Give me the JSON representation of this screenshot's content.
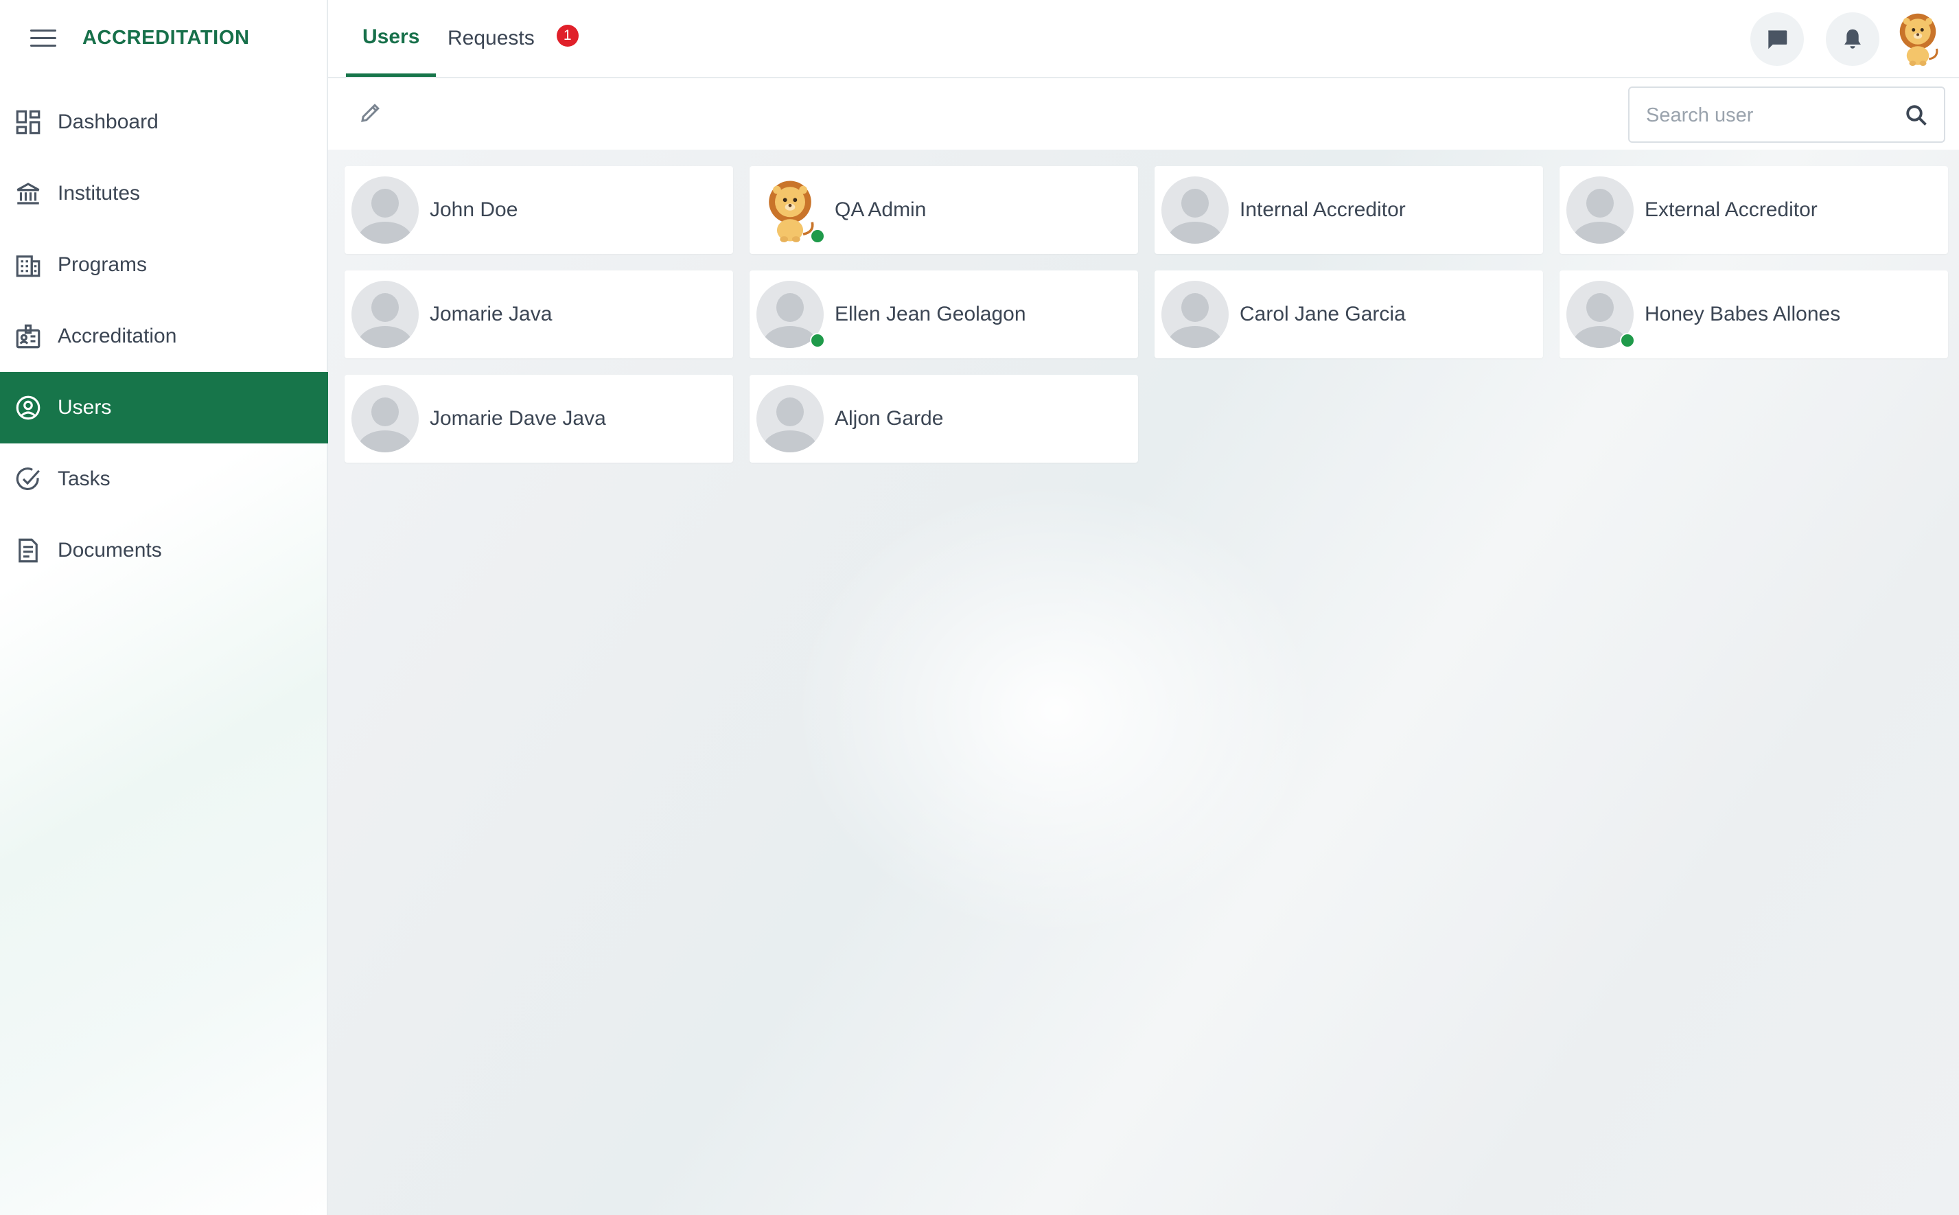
{
  "app": {
    "title": "ACCREDITATION"
  },
  "sidebar": {
    "items": [
      {
        "label": "Dashboard",
        "icon": "dashboard-icon",
        "active": false
      },
      {
        "label": "Institutes",
        "icon": "institution-icon",
        "active": false
      },
      {
        "label": "Programs",
        "icon": "building-icon",
        "active": false
      },
      {
        "label": "Accreditation",
        "icon": "id-badge-icon",
        "active": false
      },
      {
        "label": "Users",
        "icon": "user-circle-icon",
        "active": true
      },
      {
        "label": "Tasks",
        "icon": "check-circle-icon",
        "active": false
      },
      {
        "label": "Documents",
        "icon": "document-icon",
        "active": false
      }
    ]
  },
  "header": {
    "tabs": [
      {
        "label": "Users",
        "active": true
      },
      {
        "label": "Requests",
        "active": false,
        "badge": "1"
      }
    ],
    "actions": [
      "chat-icon",
      "bell-icon"
    ],
    "user_avatar": "lion-avatar"
  },
  "toolbar": {
    "edit_icon": "pencil-icon",
    "search": {
      "placeholder": "Search user",
      "value": ""
    }
  },
  "users": [
    {
      "name": "John Doe",
      "avatar": "default",
      "online": false
    },
    {
      "name": "QA Admin",
      "avatar": "lion",
      "online": true
    },
    {
      "name": "Internal Accreditor",
      "avatar": "default",
      "online": false
    },
    {
      "name": "External Accreditor",
      "avatar": "default",
      "online": false
    },
    {
      "name": "Jomarie Java",
      "avatar": "default",
      "online": false
    },
    {
      "name": "Ellen Jean Geolagon",
      "avatar": "default",
      "online": true
    },
    {
      "name": "Carol Jane Garcia",
      "avatar": "default",
      "online": false
    },
    {
      "name": "Honey Babes Allones",
      "avatar": "default",
      "online": true
    },
    {
      "name": "Jomarie Dave Java",
      "avatar": "default",
      "online": false
    },
    {
      "name": "Aljon Garde",
      "avatar": "default",
      "online": false
    }
  ],
  "colors": {
    "primary": "#17754a",
    "badge": "#e0202a",
    "online": "#1f9a4a"
  }
}
